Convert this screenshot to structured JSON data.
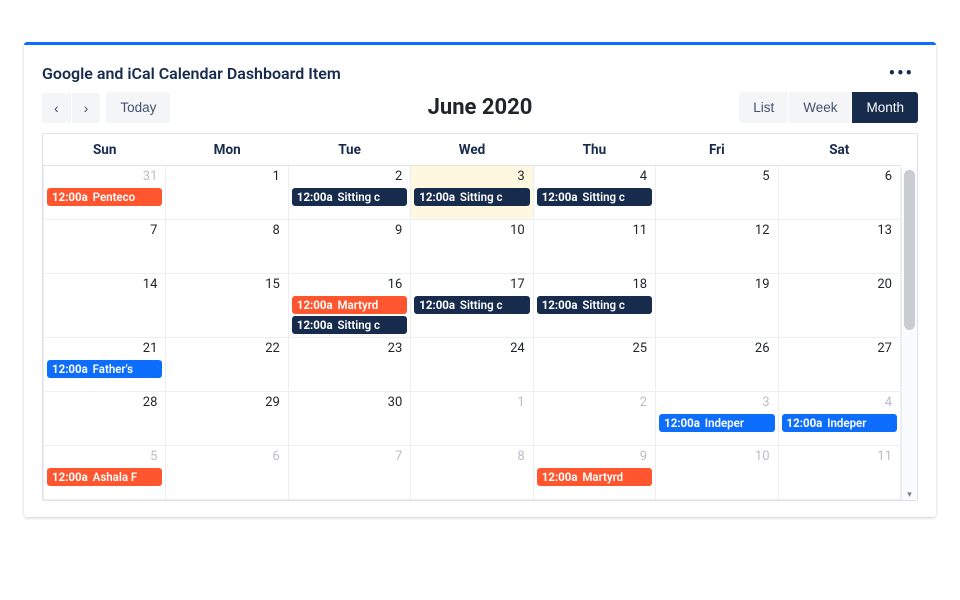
{
  "card": {
    "title": "Google and iCal Calendar Dashboard Item"
  },
  "toolbar": {
    "prev": "‹",
    "next": "›",
    "today": "Today",
    "title": "June 2020",
    "views": {
      "list": "List",
      "week": "Week",
      "month": "Month"
    },
    "active_view": "Month"
  },
  "day_headers": [
    "Sun",
    "Mon",
    "Tue",
    "Wed",
    "Thu",
    "Fri",
    "Sat"
  ],
  "colors": {
    "navy": "#172b4d",
    "blue": "#0d6efd",
    "orange": "#ff5630"
  },
  "weeks": [
    {
      "days": [
        {
          "n": "31",
          "other": true,
          "events": [
            {
              "time": "12:00a",
              "title": "Penteco",
              "color": "orange"
            }
          ]
        },
        {
          "n": "1",
          "events": []
        },
        {
          "n": "2",
          "events": [
            {
              "time": "12:00a",
              "title": "Sitting c",
              "color": "navy"
            }
          ]
        },
        {
          "n": "3",
          "today": true,
          "events": [
            {
              "time": "12:00a",
              "title": "Sitting c",
              "color": "navy"
            }
          ]
        },
        {
          "n": "4",
          "events": [
            {
              "time": "12:00a",
              "title": "Sitting c",
              "color": "navy"
            }
          ]
        },
        {
          "n": "5",
          "events": []
        },
        {
          "n": "6",
          "events": []
        }
      ]
    },
    {
      "days": [
        {
          "n": "7",
          "events": []
        },
        {
          "n": "8",
          "events": []
        },
        {
          "n": "9",
          "events": []
        },
        {
          "n": "10",
          "events": []
        },
        {
          "n": "11",
          "events": []
        },
        {
          "n": "12",
          "events": []
        },
        {
          "n": "13",
          "events": []
        }
      ]
    },
    {
      "days": [
        {
          "n": "14",
          "events": []
        },
        {
          "n": "15",
          "events": []
        },
        {
          "n": "16",
          "events": [
            {
              "time": "12:00a",
              "title": "Martyrd",
              "color": "orange"
            },
            {
              "time": "12:00a",
              "title": "Sitting c",
              "color": "navy"
            }
          ]
        },
        {
          "n": "17",
          "events": [
            {
              "time": "12:00a",
              "title": "Sitting c",
              "color": "navy"
            }
          ]
        },
        {
          "n": "18",
          "events": [
            {
              "time": "12:00a",
              "title": "Sitting c",
              "color": "navy"
            }
          ]
        },
        {
          "n": "19",
          "events": []
        },
        {
          "n": "20",
          "events": []
        }
      ]
    },
    {
      "days": [
        {
          "n": "21",
          "events": [
            {
              "time": "12:00a",
              "title": "Father's",
              "color": "blue"
            }
          ]
        },
        {
          "n": "22",
          "events": []
        },
        {
          "n": "23",
          "events": []
        },
        {
          "n": "24",
          "events": []
        },
        {
          "n": "25",
          "events": []
        },
        {
          "n": "26",
          "events": []
        },
        {
          "n": "27",
          "events": []
        }
      ]
    },
    {
      "days": [
        {
          "n": "28",
          "events": []
        },
        {
          "n": "29",
          "events": []
        },
        {
          "n": "30",
          "events": []
        },
        {
          "n": "1",
          "other": true,
          "events": []
        },
        {
          "n": "2",
          "other": true,
          "events": []
        },
        {
          "n": "3",
          "other": true,
          "events": [
            {
              "time": "12:00a",
              "title": "Indeper",
              "color": "blue"
            }
          ]
        },
        {
          "n": "4",
          "other": true,
          "events": [
            {
              "time": "12:00a",
              "title": "Indeper",
              "color": "blue"
            }
          ]
        }
      ]
    },
    {
      "days": [
        {
          "n": "5",
          "other": true,
          "events": [
            {
              "time": "12:00a",
              "title": "Ashala F",
              "color": "orange"
            }
          ]
        },
        {
          "n": "6",
          "other": true,
          "events": []
        },
        {
          "n": "7",
          "other": true,
          "events": []
        },
        {
          "n": "8",
          "other": true,
          "events": []
        },
        {
          "n": "9",
          "other": true,
          "events": [
            {
              "time": "12:00a",
              "title": "Martyrd",
              "color": "orange"
            }
          ]
        },
        {
          "n": "10",
          "other": true,
          "events": []
        },
        {
          "n": "11",
          "other": true,
          "events": []
        }
      ]
    }
  ]
}
